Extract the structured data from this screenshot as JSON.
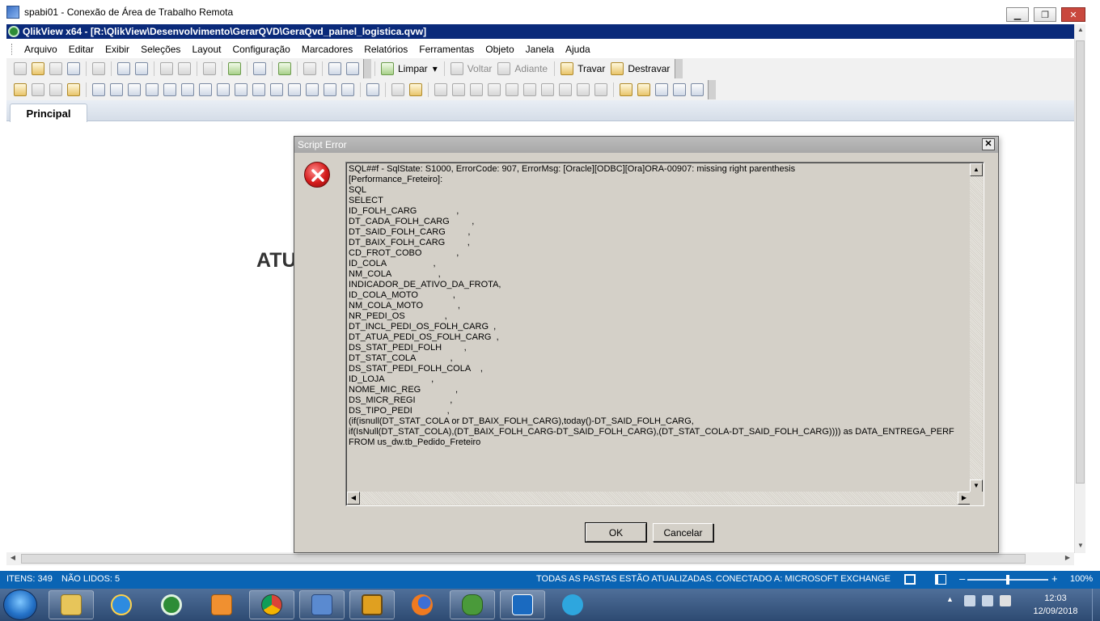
{
  "rdp": {
    "title": "spabi01 - Conexão de Área de Trabalho Remota"
  },
  "qlikview": {
    "title": "QlikView x64 - [R:\\QlikView\\Desenvolvimento\\GerarQVD\\GeraQvd_painel_logistica.qvw]"
  },
  "menu": [
    "Arquivo",
    "Editar",
    "Exibir",
    "Seleções",
    "Layout",
    "Configuração",
    "Marcadores",
    "Relatórios",
    "Ferramentas",
    "Objeto",
    "Janela",
    "Ajuda"
  ],
  "toolbar": {
    "limpar": "Limpar",
    "voltar": "Voltar",
    "adiante": "Adiante",
    "travar": "Travar",
    "destravar": "Destravar"
  },
  "tabs": [
    {
      "label": "Principal"
    }
  ],
  "sheet": {
    "partial_text": "ATU"
  },
  "dialog": {
    "title": "Script Error",
    "message": "SQL##f - SqlState: S1000, ErrorCode: 907, ErrorMsg: [Oracle][ODBC][Ora]ORA-00907: missing right parenthesis\n[Performance_Freteiro]:\nSQL\nSELECT\nID_FOLH_CARG                ,\nDT_CADA_FOLH_CARG         ,\nDT_SAID_FOLH_CARG         ,\nDT_BAIX_FOLH_CARG         ,\nCD_FROT_COBO              ,\nID_COLA                   ,\nNM_COLA                   ,\nINDICADOR_DE_ATIVO_DA_FROTA,\nID_COLA_MOTO              ,\nNM_COLA_MOTO              ,\nNR_PEDI_OS                ,\nDT_INCL_PEDI_OS_FOLH_CARG  ,\nDT_ATUA_PEDI_OS_FOLH_CARG  ,\nDS_STAT_PEDI_FOLH         ,\nDT_STAT_COLA              ,\nDS_STAT_PEDI_FOLH_COLA    ,\nID_LOJA                   ,\nNOME_MIC_REG              ,\nDS_MICR_REGI              ,\nDS_TIPO_PEDI              ,\n(if(isnull(DT_STAT_COLA or DT_BAIX_FOLH_CARG),today()-DT_SAID_FOLH_CARG,\nif(IsNull(DT_STAT_COLA),(DT_BAIX_FOLH_CARG-DT_SAID_FOLH_CARG),(DT_STAT_COLA-DT_SAID_FOLH_CARG)))) as DATA_ENTREGA_PERF\nFROM us_dw.tb_Pedido_Freteiro",
    "ok": "OK",
    "cancel": "Cancelar"
  },
  "statusbar": {
    "items": "ITENS: 349",
    "unread": "NÃO LIDOS: 5",
    "folders": "TODAS AS PASTAS ESTÃO ATUALIZADAS.",
    "connected": "CONECTADO A: MICROSOFT EXCHANGE",
    "zoom": "100%",
    "zoom_minus": "–",
    "zoom_plus": "+"
  },
  "taskbar": {
    "time": "12:03",
    "date": "12/09/2018",
    "apps": [
      "file-explorer-icon",
      "internet-explorer-icon",
      "qlikview-icon",
      "media-player-icon",
      "chrome-icon",
      "remote-desktop-icon",
      "cpu-app-icon",
      "firefox-icon",
      "frog-app-icon",
      "outlook-icon",
      "telegram-icon"
    ]
  },
  "colors": {
    "qv_title": "#0a2a7a",
    "statusbar": "#0a64b4",
    "dialog_bg": "#d4d0c8"
  }
}
